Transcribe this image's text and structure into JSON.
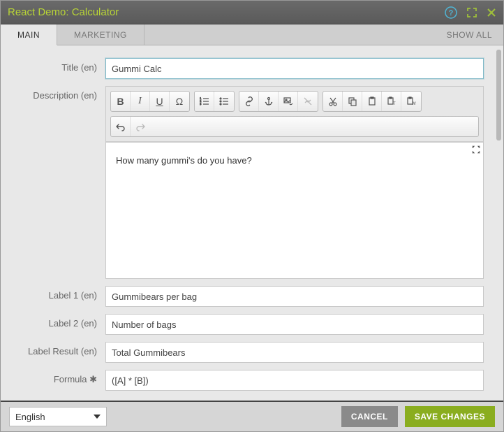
{
  "header": {
    "title": "React Demo: Calculator"
  },
  "tabs": {
    "main": "MAIN",
    "marketing": "MARKETING",
    "showall": "SHOW ALL"
  },
  "form": {
    "title_label": "Title (en)",
    "title_value": "Gummi Calc",
    "description_label": "Description (en)",
    "description_value": "How many gummi's do you have?",
    "label1_label": "Label 1 (en)",
    "label1_value": "Gummibears per bag",
    "label2_label": "Label 2 (en)",
    "label2_value": "Number of bags",
    "labelresult_label": "Label Result (en)",
    "labelresult_value": "Total Gummibears",
    "formula_label": "Formula ✱",
    "formula_value": "([A] * [B])"
  },
  "footer": {
    "language": "English",
    "cancel": "CANCEL",
    "save": "SAVE CHANGES"
  },
  "rte_icons": {
    "bold": "B",
    "italic": "I",
    "underline": "U",
    "omega": "Ω"
  }
}
